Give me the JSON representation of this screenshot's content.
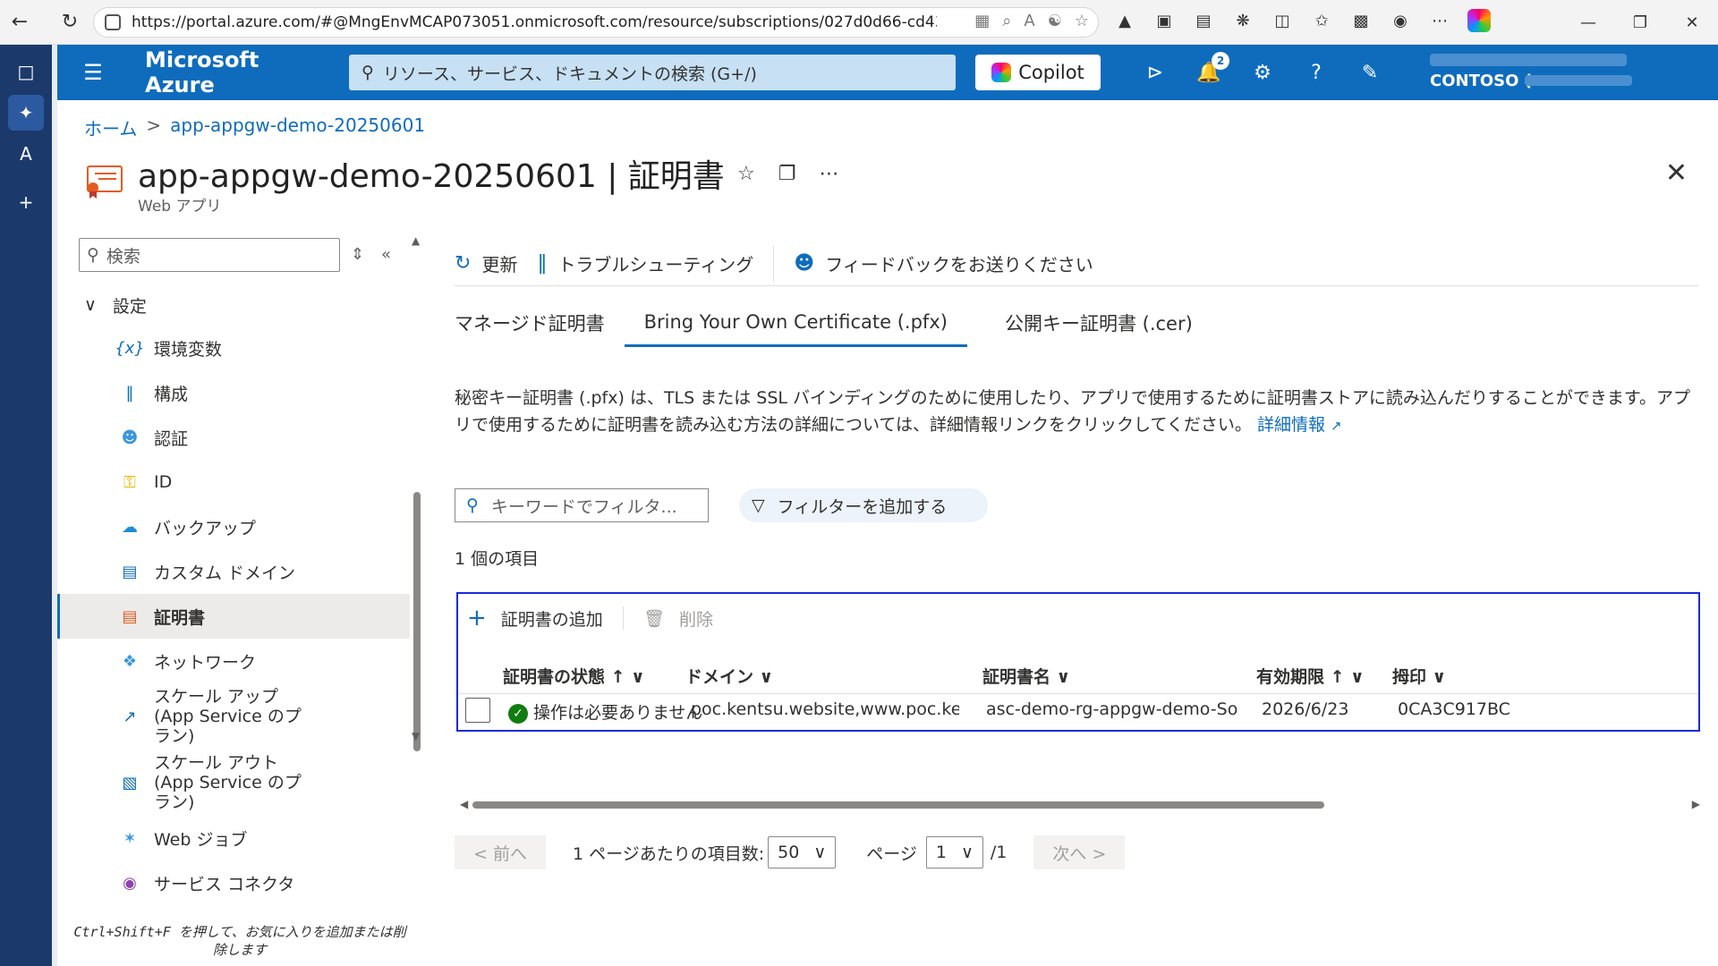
{
  "browser": {
    "url": "https://portal.azure.com/#@MngEnvMCAP073051.onmicrosoft.com/resource/subscriptions/027d0d66-cd43-43d..."
  },
  "header": {
    "brand": "Microsoft Azure",
    "search_placeholder": "リソース、サービス、ドキュメントの検索 (G+/)",
    "copilot_label": "Copilot",
    "notification_count": "2",
    "account_tenant": "CONTOSO ("
  },
  "breadcrumb": {
    "home": "ホーム",
    "resource": "app-appgw-demo-20250601"
  },
  "page": {
    "title": "app-appgw-demo-20250601 | 証明書",
    "subtitle": "Web アプリ"
  },
  "nav": {
    "search_placeholder": "検索",
    "group": "設定",
    "items": [
      {
        "label": "環境変数"
      },
      {
        "label": "構成"
      },
      {
        "label": "認証"
      },
      {
        "label": "ID"
      },
      {
        "label": "バックアップ"
      },
      {
        "label": "カスタム ドメイン"
      },
      {
        "label": "証明書"
      },
      {
        "label": "ネットワーク"
      },
      {
        "label": "スケール アップ (App Service のプラン)"
      },
      {
        "label": "スケール アウト (App Service のプラン)"
      },
      {
        "label": "Web ジョブ"
      },
      {
        "label": "サービス コネクタ"
      }
    ],
    "hint": "Ctrl+Shift+F を押して、お気に入りを追加または削除します"
  },
  "toolbar": {
    "refresh": "更新",
    "troubleshoot": "トラブルシューティング",
    "feedback": "フィードバックをお送りください"
  },
  "tabs": [
    {
      "label": "マネージド証明書"
    },
    {
      "label": "Bring Your Own Certificate (.pfx)"
    },
    {
      "label": "公開キー証明書 (.cer)"
    }
  ],
  "description": {
    "text": "秘密キー証明書 (.pfx) は、TLS または SSL バインディングのために使用したり、アプリで使用するために証明書ストアに読み込んだりすることができます。アプリで使用するために証明書を読み込む方法の詳細については、詳細情報リンクをクリックしてください。",
    "link": "詳細情報"
  },
  "filter": {
    "placeholder": "キーワードでフィルタ...",
    "add_filter": "フィルターを追加する"
  },
  "item_count": "1 個の項目",
  "grid": {
    "add": "証明書の追加",
    "delete": "削除",
    "columns": {
      "status": "証明書の状態",
      "domain": "ドメイン",
      "name": "証明書名",
      "expiry": "有効期限",
      "thumbprint": "拇印"
    },
    "rows": [
      {
        "status": "操作は必要ありません",
        "domain": "poc.kentsu.website,www.poc.kentsu.we...",
        "name": "asc-demo-rg-appgw-demo-Southea...",
        "expiry": "2026/6/23",
        "thumbprint": "0CA3C917BC"
      }
    ]
  },
  "pager": {
    "prev": "< 前へ",
    "per_page_label": "1 ページあたりの項目数:",
    "per_page": "50",
    "page_label": "ページ",
    "page": "1",
    "total": "/1",
    "next": "次へ >"
  }
}
